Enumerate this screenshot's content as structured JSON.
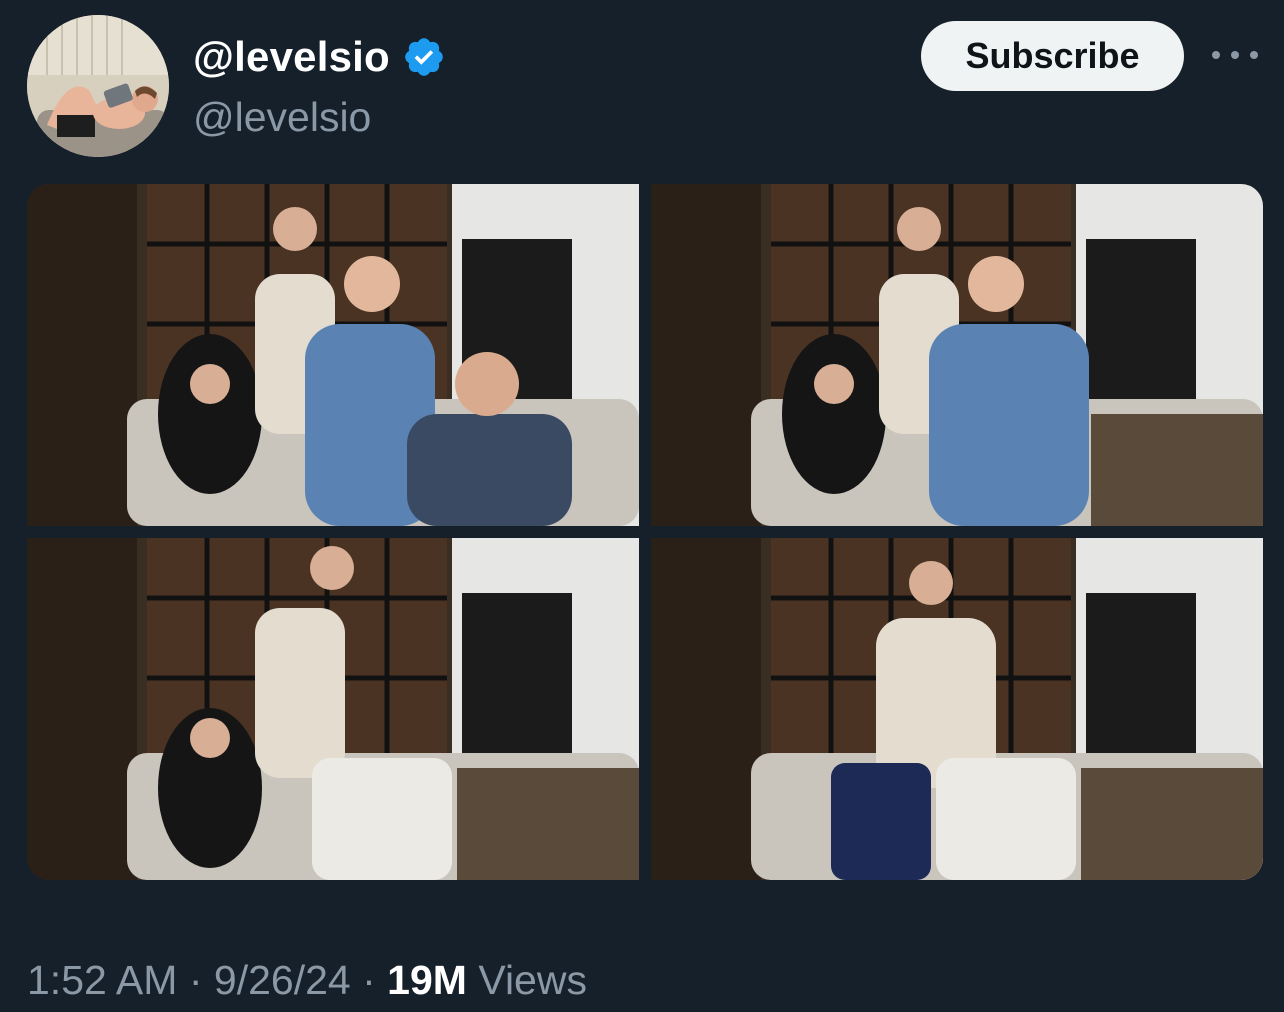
{
  "author": {
    "display_name": "@levelsio",
    "handle": "@levelsio",
    "verified": true,
    "verified_badge_color": "#1d9bf0"
  },
  "actions": {
    "subscribe_label": "Subscribe",
    "more_icon": "ellipsis-icon"
  },
  "media": {
    "photo_count": 4,
    "photos": [
      {
        "people_shown": 4
      },
      {
        "people_shown": 3
      },
      {
        "people_shown": 2
      },
      {
        "people_shown": 1
      }
    ]
  },
  "meta": {
    "time": "1:52 AM",
    "separator": "·",
    "date": "9/26/24",
    "views_count": "19M",
    "views_label": "Views"
  },
  "colors": {
    "background": "#15202b",
    "secondary_text": "#8b98a5",
    "subscribe_bg": "#eff3f4"
  }
}
